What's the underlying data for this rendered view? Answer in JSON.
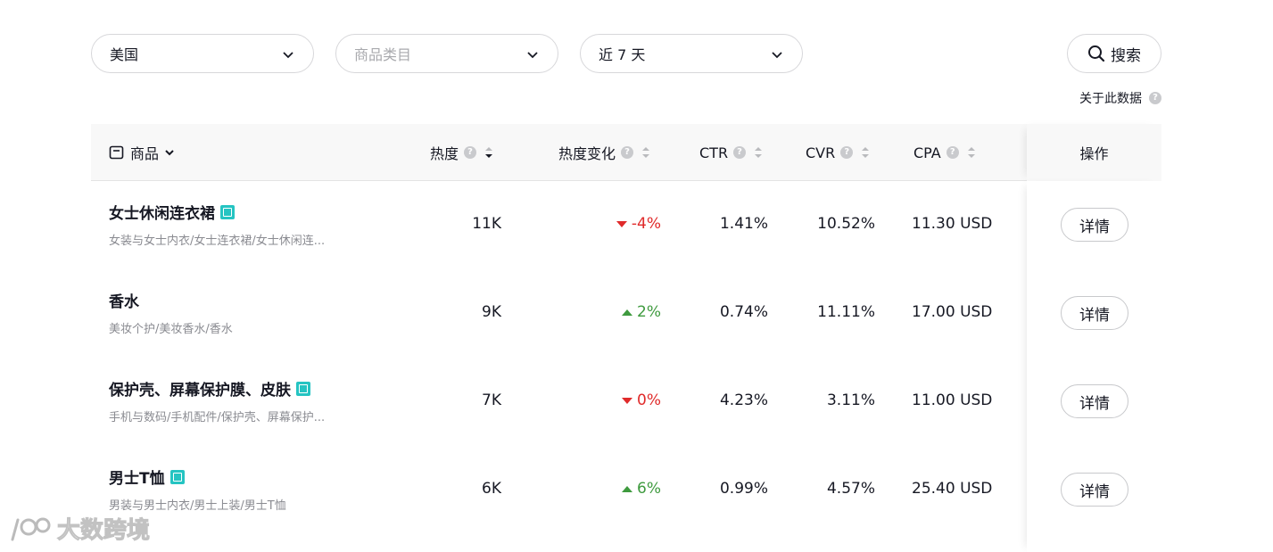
{
  "filters": {
    "region": "美国",
    "category_placeholder": "商品类目",
    "period": "近 7 天",
    "search_label": "搜索"
  },
  "about_label": "关于此数据",
  "table": {
    "headers": {
      "product": "商品",
      "heat": "热度",
      "heat_change": "热度变化",
      "ctr": "CTR",
      "cvr": "CVR",
      "cpa": "CPA",
      "actions": "操作"
    },
    "rows": [
      {
        "name": "女士休闲连衣裙",
        "has_image": true,
        "category": "女装与女士内衣/女士连衣裙/女士休闲连...",
        "heat": "11K",
        "change": "-4%",
        "trend": "down",
        "ctr": "1.41%",
        "cvr": "10.52%",
        "cpa": "11.30 USD",
        "action": "详情"
      },
      {
        "name": "香水",
        "has_image": false,
        "category": "美妆个护/美妆香水/香水",
        "heat": "9K",
        "change": "2%",
        "trend": "up",
        "ctr": "0.74%",
        "cvr": "11.11%",
        "cpa": "17.00 USD",
        "action": "详情"
      },
      {
        "name": "保护壳、屏幕保护膜、皮肤",
        "has_image": true,
        "category": "手机与数码/手机配件/保护壳、屏幕保护...",
        "heat": "7K",
        "change": "0%",
        "trend": "down",
        "ctr": "4.23%",
        "cvr": "3.11%",
        "cpa": "11.00 USD",
        "action": "详情"
      },
      {
        "name": "男士T恤",
        "has_image": true,
        "category": "男装与男士内衣/男士上装/男士T恤",
        "heat": "6K",
        "change": "6%",
        "trend": "up",
        "ctr": "0.99%",
        "cvr": "4.57%",
        "cpa": "25.40 USD",
        "action": "详情"
      }
    ]
  },
  "watermark": "大数跨境",
  "colors": {
    "down": "#e02a2a",
    "up": "#3e9a3e",
    "image_badge": "#25c4c2"
  }
}
